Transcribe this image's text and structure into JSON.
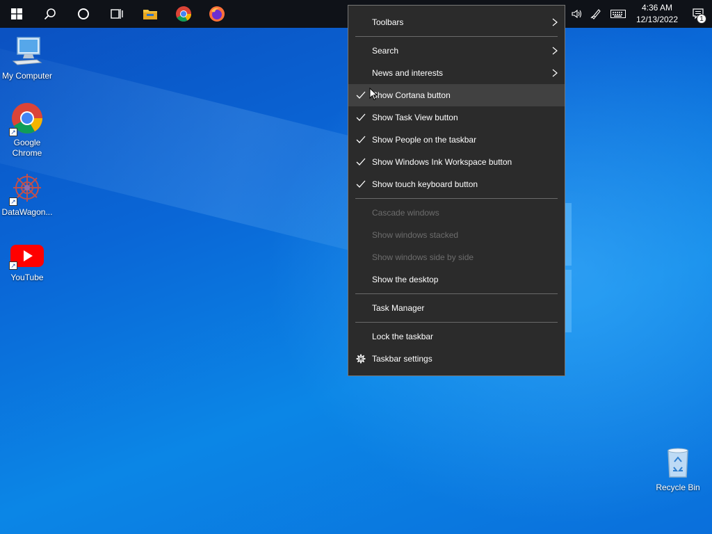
{
  "taskbar": {
    "buttons": [
      "start-icon",
      "search-icon",
      "cortana-icon",
      "task-view-icon",
      "file-explorer-icon",
      "chrome-icon",
      "firefox-icon"
    ],
    "tray": {
      "clock_time": "4:36 AM",
      "clock_date": "12/13/2022",
      "notification_count": "1"
    }
  },
  "desktop": {
    "icons": [
      {
        "label": "My Computer"
      },
      {
        "label": "Google Chrome"
      },
      {
        "label": "DataWagon..."
      },
      {
        "label": "YouTube"
      },
      {
        "label": "Recycle Bin"
      }
    ]
  },
  "context_menu": {
    "toolbars": "Toolbars",
    "search": "Search",
    "news": "News and interests",
    "show_cortana": "Show Cortana button",
    "show_task_view": "Show Task View button",
    "show_people": "Show People on the taskbar",
    "show_ink": "Show Windows Ink Workspace button",
    "show_touch_keyboard": "Show touch keyboard button",
    "cascade": "Cascade windows",
    "stacked": "Show windows stacked",
    "side_by_side": "Show windows side by side",
    "show_desktop": "Show the desktop",
    "task_manager": "Task Manager",
    "lock_taskbar": "Lock the taskbar",
    "taskbar_settings": "Taskbar settings"
  },
  "colors": {
    "menu_bg": "#2b2b2b",
    "menu_hover": "#414141",
    "taskbar_bg": "#0f1218",
    "disabled_text": "#6d6d6d"
  }
}
